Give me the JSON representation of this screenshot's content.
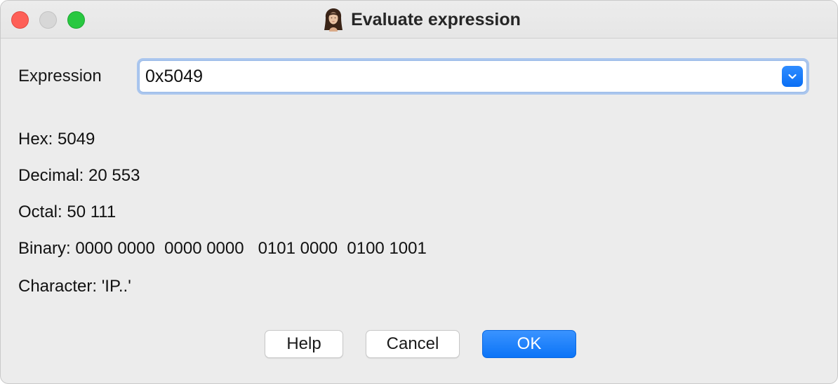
{
  "window": {
    "title": "Evaluate expression",
    "app_icon": "portrait-icon"
  },
  "expression": {
    "label": "Expression",
    "value": "0x5049",
    "dropdown_icon": "chevron-down-icon"
  },
  "results": {
    "hex": "Hex: 5049",
    "decimal": "Decimal: 20 553",
    "octal": "Octal: 50 111",
    "binary": "Binary: 0000 0000  0000 0000   0101 0000  0100 1001",
    "character": "Character: 'IP..'"
  },
  "buttons": {
    "help": "Help",
    "cancel": "Cancel",
    "ok": "OK"
  },
  "colors": {
    "accent": "#0b74f7",
    "close": "#fe5f57",
    "minimize": "#d7d7d7",
    "maximize": "#28c840"
  }
}
